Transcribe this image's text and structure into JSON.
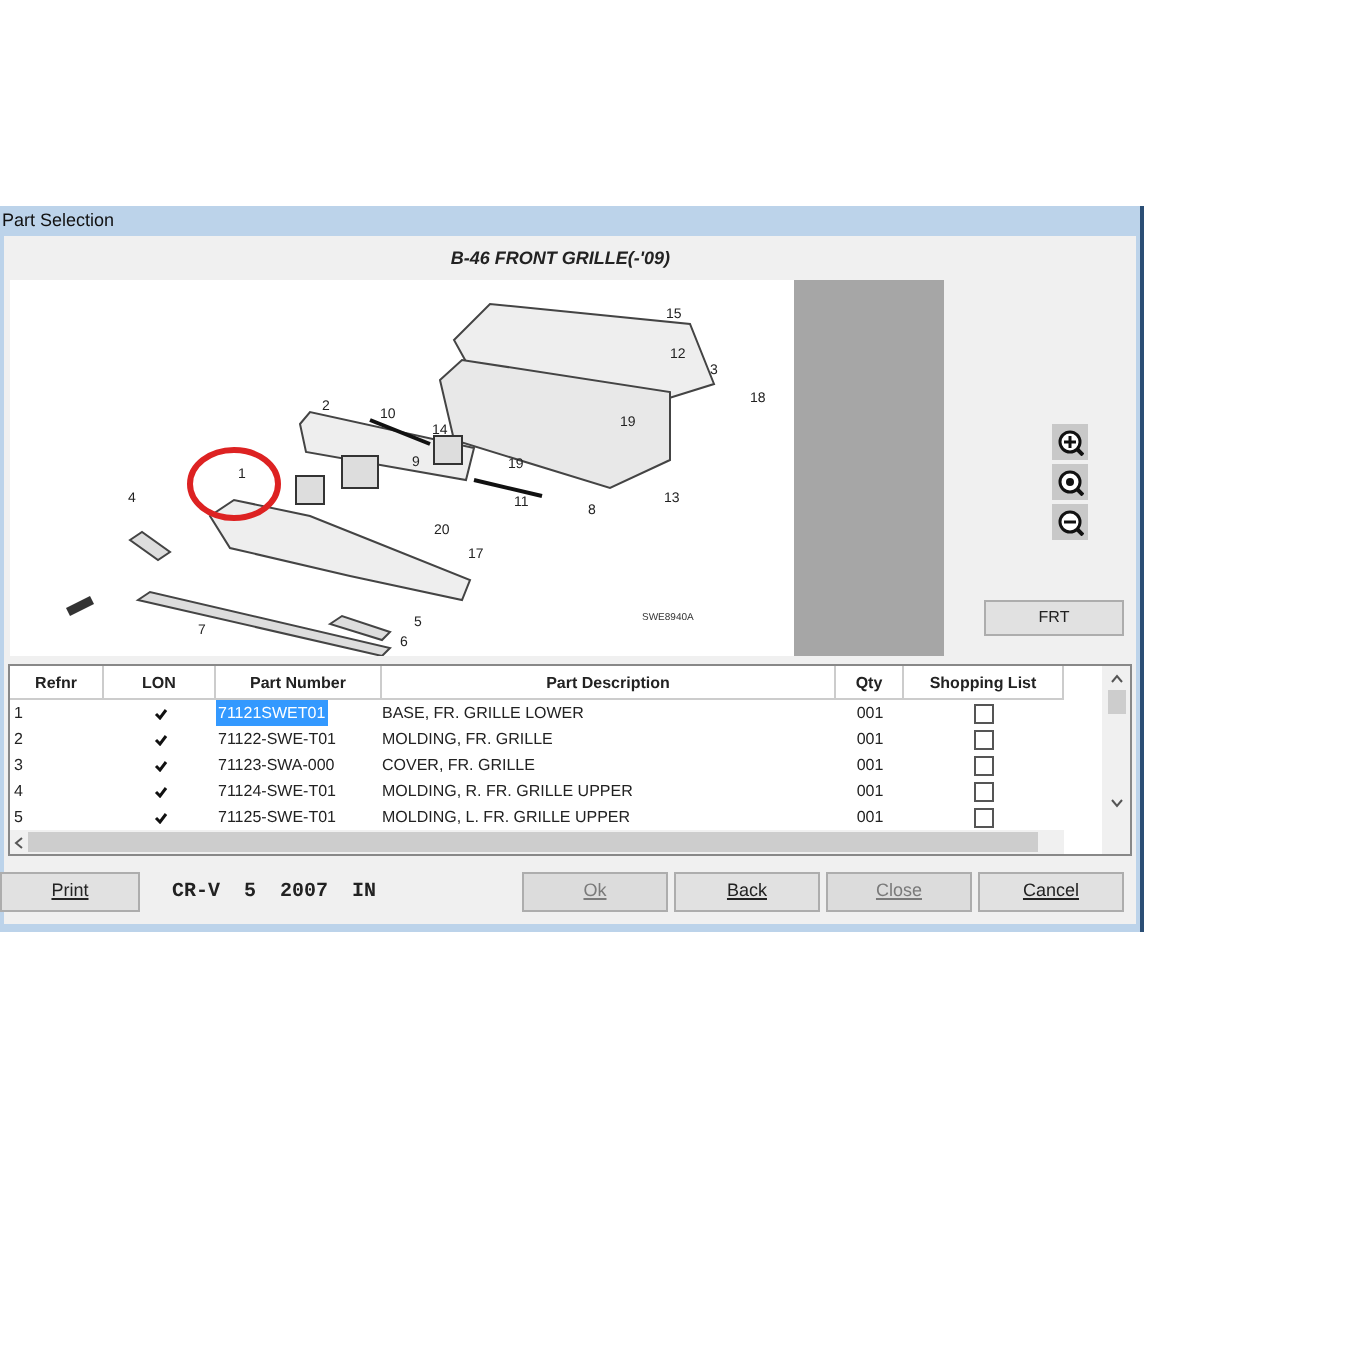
{
  "window": {
    "title": "Part Selection"
  },
  "diagram": {
    "title": "B-46 FRONT GRILLE(-'09)",
    "drawing_code": "SWE8940A",
    "callouts": [
      "15",
      "12",
      "3",
      "18",
      "19",
      "2",
      "10",
      "14",
      "9",
      "19",
      "11",
      "8",
      "13",
      "1",
      "4",
      "20",
      "17",
      "7",
      "5",
      "6"
    ]
  },
  "zoom_buttons": [
    {
      "kind": "zoom_in"
    },
    {
      "kind": "zoom_fit"
    },
    {
      "kind": "zoom_out"
    }
  ],
  "frt_button": "FRT",
  "table": {
    "columns": [
      "Refnr",
      "LON",
      "Part Number",
      "Part Description",
      "Qty",
      "Shopping List"
    ],
    "rows": [
      {
        "refnr": "1",
        "lon": true,
        "part_number": "71121SWET01",
        "description": "BASE, FR. GRILLE LOWER",
        "qty": "001",
        "shopping": false,
        "selected": true
      },
      {
        "refnr": "2",
        "lon": true,
        "part_number": "71122-SWE-T01",
        "description": "MOLDING, FR. GRILLE",
        "qty": "001",
        "shopping": false,
        "selected": false
      },
      {
        "refnr": "3",
        "lon": true,
        "part_number": "71123-SWA-000",
        "description": "COVER, FR. GRILLE",
        "qty": "001",
        "shopping": false,
        "selected": false
      },
      {
        "refnr": "4",
        "lon": true,
        "part_number": "71124-SWE-T01",
        "description": "MOLDING, R. FR. GRILLE UPPER",
        "qty": "001",
        "shopping": false,
        "selected": false
      },
      {
        "refnr": "5",
        "lon": true,
        "part_number": "71125-SWE-T01",
        "description": "MOLDING, L. FR. GRILLE UPPER",
        "qty": "001",
        "shopping": false,
        "selected": false
      }
    ]
  },
  "footer": {
    "print_button": {
      "label": "Print",
      "disabled": false
    },
    "vehicle": "CR-V  5  2007  IN",
    "buttons": [
      {
        "label": "Ok",
        "disabled": true
      },
      {
        "label": "Back",
        "disabled": false
      },
      {
        "label": "Close",
        "disabled": true
      },
      {
        "label": "Cancel",
        "disabled": false
      }
    ]
  }
}
